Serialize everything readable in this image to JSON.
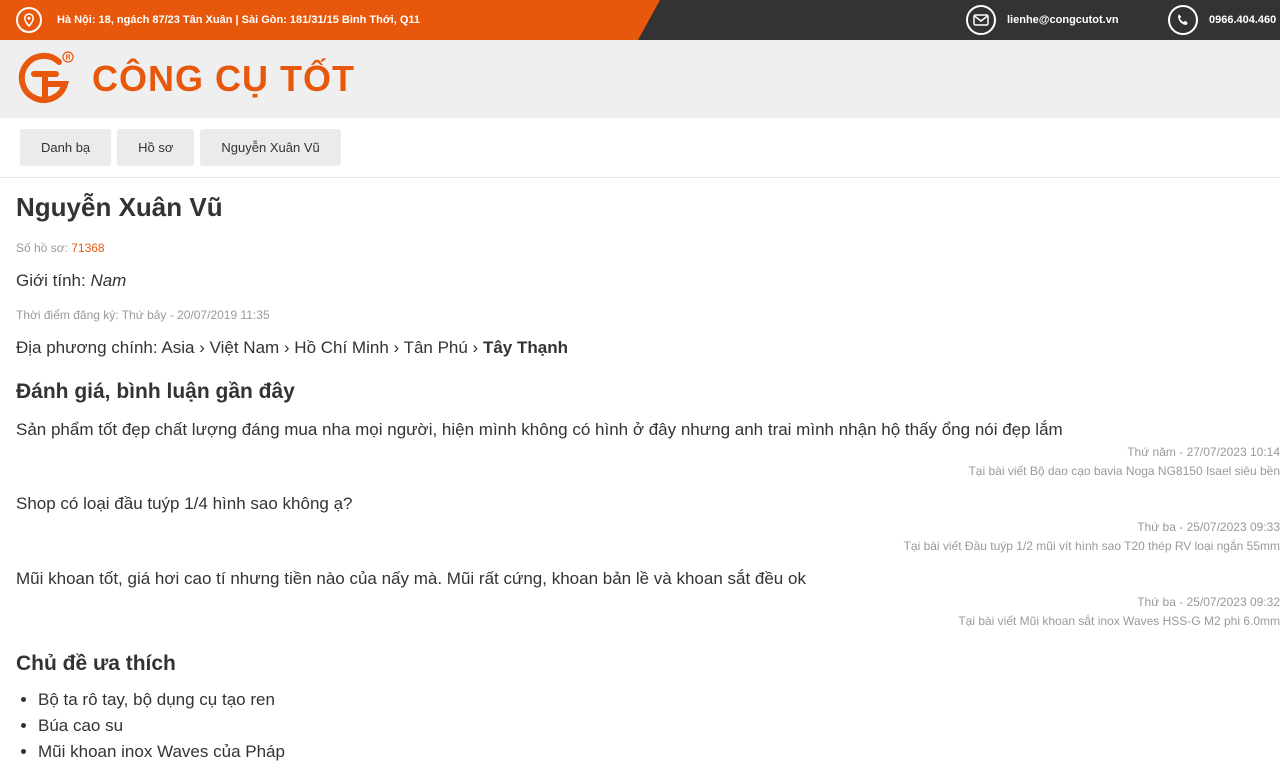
{
  "topbar": {
    "address": "Hà Nội: 18, ngách 87/23 Tân Xuân | Sài Gòn: 181/31/15 Bình Thới, Q11",
    "email": "lienhe@congcutot.vn",
    "phone": "0966.404.460",
    "icons": [
      "map-pin-icon",
      "mail-icon",
      "phone-icon"
    ]
  },
  "header": {
    "logo_text": "CÔNG CỤ TỐT",
    "logo_mark": "GT"
  },
  "breadcrumb": [
    {
      "label": "Danh bạ"
    },
    {
      "label": "Hồ sơ"
    },
    {
      "label": "Nguyễn Xuân Vũ"
    }
  ],
  "profile": {
    "name": "Nguyễn Xuân Vũ",
    "profile_no_label": "Số hồ sơ: ",
    "profile_no": "71368",
    "gender_label": "Giới tính: ",
    "gender": "Nam",
    "registered": "Thời điểm đăng ký: Thứ bảy - 20/07/2019 11:35",
    "location_label": "Địa phương chính: ",
    "location_path": "Asia › Việt Nam › Hồ Chí Minh › Tân Phú › ",
    "location_last": "Tây Thạnh"
  },
  "reviews": {
    "heading": "Đánh giá, bình luận gần đây",
    "items": [
      {
        "text": "Sản phẩm tốt đẹp chất lượng đáng mua nha mọi người, hiện mình không có hình ở đây nhưng anh trai mình nhận hộ thấy ổng nói đẹp lắm",
        "time": "Thứ năm - 27/07/2023 10:14",
        "post": "Tại bài viết Bộ dao cạo bavia Noga NG8150 Isael siêu bền"
      },
      {
        "text": "Shop có loại đầu tuýp 1/4 hình sao không ạ?",
        "time": "Thứ ba - 25/07/2023 09:33",
        "post": "Tại bài viết Đầu tuýp 1/2 mũi vít hình sao T20 thép RV loại ngắn 55mm"
      },
      {
        "text": "Mũi khoan tốt, giá hơi cao tí nhưng tiền nào của nấy mà. Mũi rất cứng, khoan bản lề và khoan sắt đều ok",
        "time": "Thứ ba - 25/07/2023 09:32",
        "post": "Tại bài viết Mũi khoan sắt inox Waves HSS-G M2 phi 6.0mm"
      }
    ]
  },
  "topics": {
    "heading": "Chủ đề ưa thích",
    "items": [
      "Bộ ta rô tay, bộ dụng cụ tạo ren",
      "Búa cao su",
      "Mũi khoan inox Waves của Pháp"
    ]
  },
  "colors": {
    "brand": "#e8580c",
    "topbar_dark": "#333333",
    "header_bg": "#efefef"
  }
}
